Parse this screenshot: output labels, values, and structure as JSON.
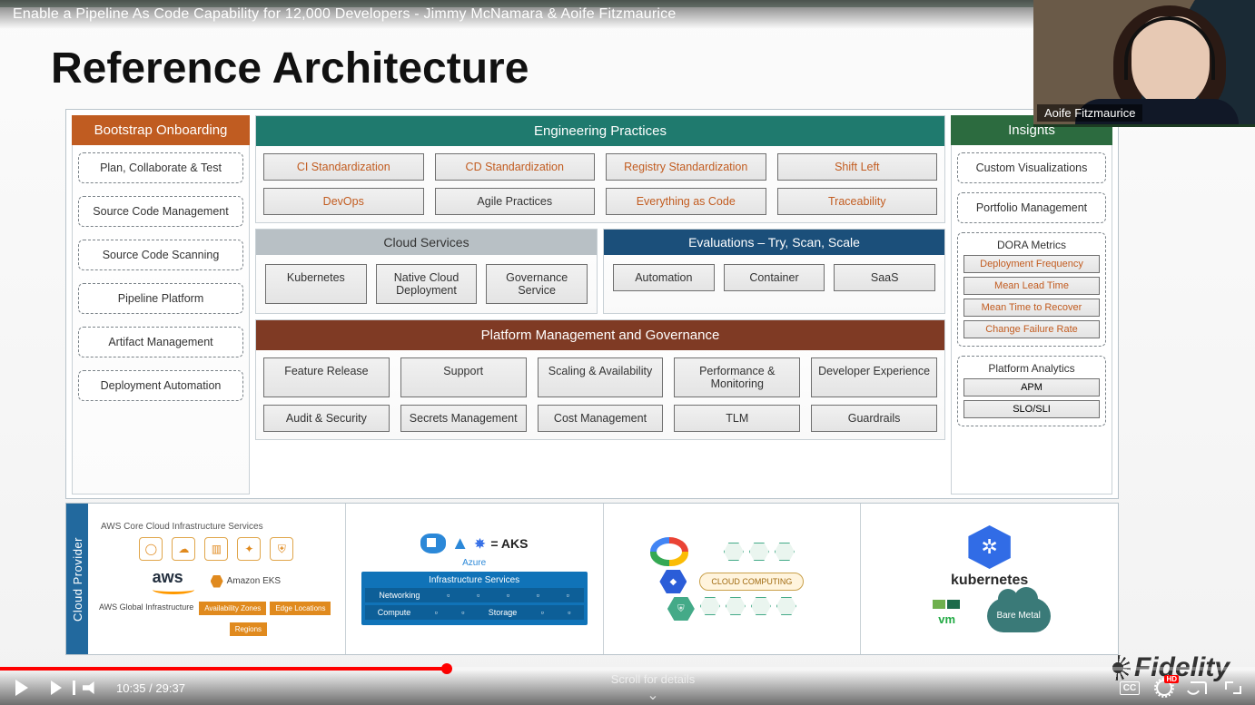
{
  "video": {
    "title": "Enable a Pipeline As Code Capability for 12,000 Developers - Jimmy McNamara & Aoife Fitzmaurice",
    "current_time": "10:35",
    "duration": "29:37",
    "progress_pct": 35.6,
    "scroll_hint": "Scroll for details",
    "speaker_tag": "Aoife Fitzmaurice",
    "watermark": "Fidelity",
    "hd_badge": "HD",
    "cc_label": "CC"
  },
  "slide": {
    "title": "Reference Architecture",
    "bootstrap": {
      "header": "Bootstrap Onboarding",
      "items": [
        "Plan, Collaborate & Test",
        "Source Code Management",
        "Source Code Scanning",
        "Pipeline Platform",
        "Artifact Management",
        "Deployment Automation"
      ]
    },
    "engineering": {
      "header": "Engineering Practices",
      "row1": [
        "CI  Standardization",
        "CD Standardization",
        "Registry Standardization",
        "Shift Left"
      ],
      "row2": [
        "DevOps",
        "Agile Practices",
        "Everything as Code",
        "Traceability"
      ],
      "row1_orange": [
        true,
        true,
        true,
        true
      ],
      "row2_orange": [
        true,
        false,
        true,
        true
      ]
    },
    "cloud_services": {
      "header": "Cloud Services",
      "items": [
        "Kubernetes",
        "Native Cloud Deployment",
        "Governance Service"
      ]
    },
    "evaluations": {
      "header": "Evaluations – Try, Scan, Scale",
      "items": [
        "Automation",
        "Container",
        "SaaS"
      ]
    },
    "pmg": {
      "header": "Platform Management and Governance",
      "row1": [
        "Feature Release",
        "Support",
        "Scaling & Availability",
        "Performance & Monitoring",
        "Developer Experience"
      ],
      "row2": [
        "Audit & Security",
        "Secrets Management",
        "Cost Management",
        "TLM",
        "Guardrails"
      ]
    },
    "insights": {
      "header": "Insights",
      "simple": [
        "Custom Visualizations",
        "Portfolio Management"
      ],
      "dora": {
        "label": "DORA Metrics",
        "items": [
          "Deployment Frequency",
          "Mean Lead Time",
          "Mean Time to Recover",
          "Change Failure Rate"
        ]
      },
      "analytics": {
        "label": "Platform Analytics",
        "items": [
          "APM",
          "SLO/SLI"
        ]
      }
    },
    "cloud_provider": {
      "side_label": "Cloud Provider",
      "aws": {
        "header": "AWS Core Cloud Infrastructure Services",
        "icons": [
          "Compute",
          "Storage & Content Delivery",
          "Database",
          "Networking",
          "Administration & Security"
        ],
        "logo": "aws",
        "eks": "Amazon EKS",
        "infra_label": "AWS Global Infrastructure",
        "strips": [
          "Availability Zones",
          "Edge Locations",
          "Regions"
        ]
      },
      "azure": {
        "cloud_label": "Azure",
        "equation": "=  AKS",
        "infra_header": "Infrastructure Services",
        "sections": [
          "Networking",
          "Compute",
          "Storage"
        ]
      },
      "gcp": {
        "center_label": "CLOUD COMPUTING"
      },
      "k8s": {
        "label": "kubernetes",
        "vm": "vm",
        "bare_metal": "Bare Metal"
      }
    }
  }
}
